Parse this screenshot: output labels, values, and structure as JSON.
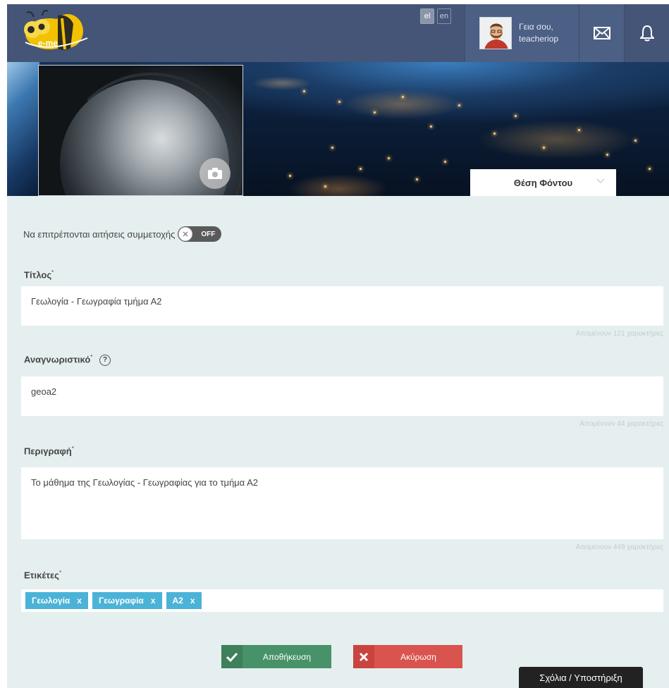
{
  "header": {
    "logo_text": "e-me",
    "languages": [
      "el",
      "en"
    ],
    "active_language": "el",
    "greeting_line1": "Γεια σου,",
    "greeting_line2": "teacheriop",
    "mail_icon": "envelope-icon",
    "bell_icon": "bell-icon"
  },
  "banner": {
    "background_position_label": "Θέση Φόντου",
    "camera_icon": "camera-icon"
  },
  "form": {
    "allow_requests_label": "Να επιτρέπονται αιτήσεις συμμετοχής",
    "allow_requests_state": "OFF",
    "title_label": "Τίτλος",
    "title_value": "Γεωλογία - Γεωγραφία τμήμα Α2",
    "title_remaining": "Απομένουν 121 χαρακτήρες",
    "identifier_label": "Αναγνωριστικό",
    "identifier_help": "?",
    "identifier_value": "geoa2",
    "identifier_remaining": "Απομένουν 44 χαρακτήρες",
    "description_label": "Περιγραφή",
    "description_value": "Το μάθημα της Γεωλογίας - Γεωγραφίας για το τμήμα Α2",
    "description_remaining": "Απομένουν 448 χαρακτήρες",
    "tags_label": "Ετικέτες",
    "required_mark": "*",
    "tags": [
      {
        "label": "Γεωλογία",
        "remove": "x"
      },
      {
        "label": "Γεωγραφία",
        "remove": "x"
      },
      {
        "label": "Α2",
        "remove": "x"
      }
    ],
    "save_label": "Αποθήκευση",
    "cancel_label": "Ακύρωση"
  },
  "feedback_label": "Σχόλια / Υποστήριξη",
  "colors": {
    "header_bg": "#445577",
    "form_bg": "#e6efef",
    "tag_bg": "#4bb3d7",
    "save_bg": "#479268",
    "cancel_bg": "#d9534f"
  }
}
